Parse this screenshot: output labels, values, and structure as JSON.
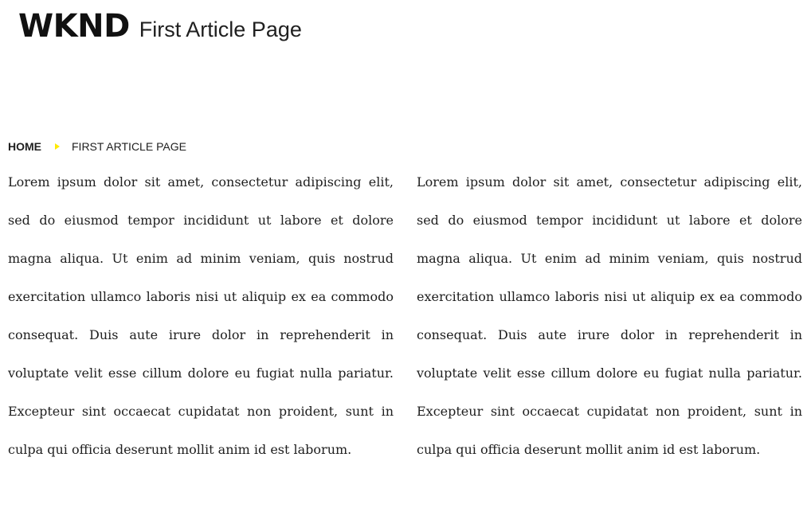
{
  "header": {
    "logo": "WKND",
    "page_title": "First Article Page"
  },
  "breadcrumb": {
    "home_label": "HOME",
    "current_label": "FIRST ARTICLE PAGE",
    "separator_color": "#ffea00"
  },
  "content": {
    "columns": [
      {
        "text": "Lorem ipsum dolor sit amet, consectetur adipiscing elit, sed do eiusmod tempor incididunt ut labore et dolore magna aliqua. Ut enim ad minim veniam, quis nostrud exercitation ullamco laboris nisi ut aliquip ex ea commodo consequat. Duis aute irure dolor in reprehenderit in voluptate velit esse cillum dolore eu fugiat nulla pariatur. Excepteur sint occaecat cupidatat non proident, sunt in culpa qui officia deserunt mollit anim id est laborum."
      },
      {
        "text": "Lorem ipsum dolor sit amet, consectetur adipiscing elit, sed do eiusmod tempor incididunt ut labore et dolore magna aliqua. Ut enim ad minim veniam, quis nostrud exercitation ullamco laboris nisi ut aliquip ex ea commodo consequat. Duis aute irure dolor in reprehenderit in voluptate velit esse cillum dolore eu fugiat nulla pariatur. Excepteur sint occaecat cupidatat non proident, sunt in culpa qui officia deserunt mollit anim id est laborum."
      }
    ]
  }
}
